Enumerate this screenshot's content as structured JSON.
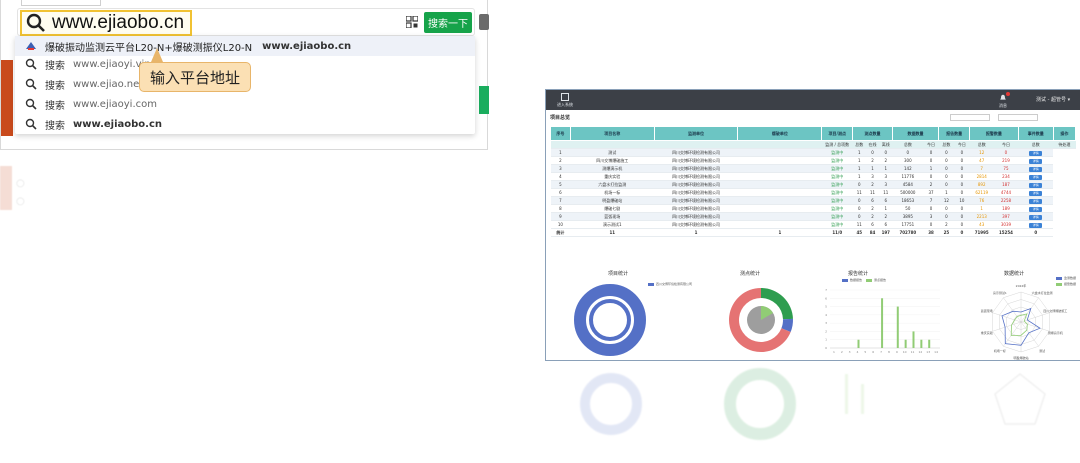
{
  "browser": {
    "search": {
      "query": "www.ejiaobo.cn",
      "button_label": "搜索一下"
    },
    "suggestions": [
      {
        "title": "爆破振动监测云平台L20-N+爆破测振仪L20-N",
        "url": "www.ejiaobo.cn",
        "type": "site"
      },
      {
        "keyword": "搜索",
        "url": "www.ejiaoyi.vip"
      },
      {
        "keyword": "搜索",
        "url": "www.ejiao.net.cn"
      },
      {
        "keyword": "搜索",
        "url": "www.ejiaoyi.com"
      },
      {
        "keyword": "搜索",
        "url": "www.ejiaobo.cn"
      }
    ],
    "tooltip": "输入平台地址"
  },
  "dashboard": {
    "logo_label": "进入系统",
    "bell_label": "消息",
    "user": "测试 - 超管号 ▾",
    "breadcrumb": "项目总览",
    "date_start": "",
    "date_end": "",
    "table": {
      "headers": [
        "序号",
        "项目名称",
        "监测单位",
        "爆破单位",
        "项目/测点",
        "测点数量",
        "数据数量",
        "报告数量",
        "报警数量",
        "事件数量",
        "操作"
      ],
      "sub_headers": [
        "监测 / 总项数",
        "总数",
        "在线",
        "离线",
        "总数",
        "今日",
        "总数",
        "今日",
        "总数",
        "今日",
        "总数",
        "待处理"
      ],
      "rows": [
        [
          "1",
          "测试",
          "四川交博环境检测有限公司",
          "",
          "监测中",
          "1",
          "0",
          "0",
          "0",
          "0",
          "0",
          "0",
          "12",
          "0",
          "详情"
        ],
        [
          "2",
          "四川交博爆破施工",
          "四川交博环境检测有限公司",
          "",
          "监测中",
          "1",
          "2",
          "2",
          "300",
          "0",
          "0",
          "0",
          "47",
          "219",
          "详情"
        ],
        [
          "3",
          "测爆演示机",
          "四川交博环境检测有限公司",
          "",
          "监测中",
          "1",
          "1",
          "1",
          "142",
          "1",
          "0",
          "0",
          "7",
          "75",
          "详情"
        ],
        [
          "4",
          "重庆实验",
          "四川交博环境检测有限公司",
          "",
          "监测中",
          "1",
          "3",
          "3",
          "11776",
          "0",
          "0",
          "0",
          "2814",
          "234",
          "详情"
        ],
        [
          "5",
          "六盘水打拉监测",
          "四川交博环境检测有限公司",
          "",
          "监测中",
          "0",
          "2",
          "3",
          "4584",
          "2",
          "0",
          "0",
          "892",
          "187",
          "详情"
        ],
        [
          "6",
          "机场一标",
          "四川交博环境检测有限公司",
          "",
          "监测中",
          "11",
          "11",
          "11",
          "500000",
          "37",
          "1",
          "0",
          "62119",
          "4744",
          "详情"
        ],
        [
          "7",
          "明盈爆破站",
          "四川交博环境检测有限公司",
          "",
          "监测中",
          "0",
          "6",
          "6",
          "18653",
          "7",
          "12",
          "10",
          "76",
          "2258",
          "详情"
        ],
        [
          "8",
          "爆破七剧",
          "四川交博环境检测有限公司",
          "",
          "监测中",
          "0",
          "2",
          "1",
          "50",
          "0",
          "0",
          "0",
          "1",
          "189",
          "详情"
        ],
        [
          "9",
          "蓝弧现场",
          "四川交博环境检测有限公司",
          "",
          "监测中",
          "0",
          "2",
          "2",
          "3895",
          "3",
          "0",
          "0",
          "2213",
          "397",
          "详情"
        ],
        [
          "10",
          "演示测试1",
          "四川交博环境检测有限公司",
          "",
          "监测中",
          "11",
          "6",
          "6",
          "17751",
          "0",
          "2",
          "0",
          "43",
          "3039",
          "详情"
        ]
      ],
      "total": [
        "统计",
        "11",
        "1",
        "1",
        "11/0",
        "45",
        "84",
        "197",
        "702780",
        "38",
        "25",
        "0",
        "71995",
        "15254",
        "0"
      ]
    },
    "charts": [
      {
        "title": "项目统计",
        "legend": [
          "四川交博环境检测有限公司"
        ]
      },
      {
        "title": "测点统计"
      },
      {
        "title": "报告统计",
        "legend": [
          "数据报告",
          "测点报告"
        ]
      },
      {
        "title": "数据统计",
        "legend": [
          "监测数据",
          "报警数据"
        ]
      }
    ]
  },
  "chart_data": [
    {
      "type": "pie",
      "title": "项目统计",
      "series": [
        {
          "name": "四川交博环境检测有限公司",
          "values": [
            11
          ]
        }
      ]
    },
    {
      "type": "pie",
      "title": "测点统计",
      "categories": [
        "机场一标",
        "重庆实验",
        "其他"
      ],
      "values": [
        11,
        3,
        31
      ]
    },
    {
      "type": "bar",
      "title": "报告统计",
      "categories": [
        "1",
        "2",
        "3",
        "4",
        "5",
        "6",
        "7",
        "8",
        "9",
        "10",
        "11",
        "12",
        "13",
        "14"
      ],
      "series": [
        {
          "name": "数据报告",
          "values": [
            0,
            0,
            0,
            0,
            0,
            0,
            0,
            0,
            0,
            0,
            0,
            0,
            0,
            0
          ]
        },
        {
          "name": "测点报告",
          "values": [
            0,
            0,
            0,
            1,
            0,
            0,
            6,
            0,
            5,
            1,
            2,
            1,
            1,
            0
          ]
        }
      ],
      "ylim": [
        0,
        7
      ]
    },
    {
      "type": "radar",
      "title": "数据统计",
      "categories": [
        "2022年",
        "六盘水打拉监测",
        "四川交博爆破施工",
        "测爆演示机",
        "测试",
        "明盈爆破站",
        "机场一标",
        "重庆实验",
        "蓝弧现场",
        "演示测试1"
      ],
      "series": [
        {
          "name": "监测数据",
          "values": [
            3,
            5,
            2,
            6,
            4,
            7,
            8,
            5,
            6,
            4
          ]
        },
        {
          "name": "报警数据",
          "values": [
            2,
            3,
            1,
            2,
            3,
            4,
            5,
            3,
            2,
            2
          ]
        }
      ]
    }
  ]
}
